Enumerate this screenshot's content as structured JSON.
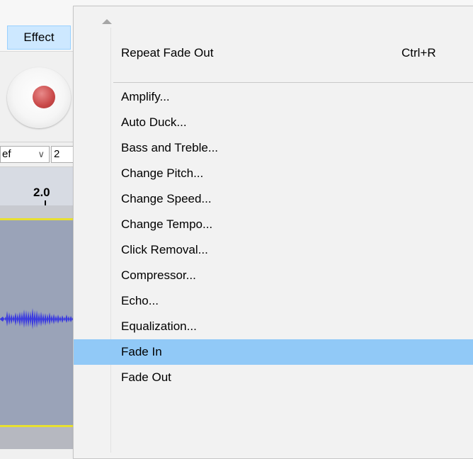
{
  "menubar": {
    "effect_label": "Effect"
  },
  "toolbar": {
    "host_value": "ef",
    "channels_value": "2"
  },
  "timeline": {
    "ruler_label": "2.0"
  },
  "effect_menu": {
    "repeat_item": {
      "label": "Repeat Fade Out",
      "shortcut": "Ctrl+R"
    },
    "items": [
      {
        "label": "Amplify..."
      },
      {
        "label": "Auto Duck..."
      },
      {
        "label": "Bass and Treble..."
      },
      {
        "label": "Change Pitch..."
      },
      {
        "label": "Change Speed..."
      },
      {
        "label": "Change Tempo..."
      },
      {
        "label": "Click Removal..."
      },
      {
        "label": "Compressor..."
      },
      {
        "label": "Echo..."
      },
      {
        "label": "Equalization..."
      },
      {
        "label": "Fade In"
      },
      {
        "label": "Fade Out"
      }
    ],
    "highlighted_label": "Fade In"
  },
  "colors": {
    "menu_highlight": "#91c9f7",
    "menubar_active": "#cde8ff",
    "waveform": "#3a3ae0",
    "track_background": "#9aa3b8",
    "record_red": "#c94848"
  }
}
